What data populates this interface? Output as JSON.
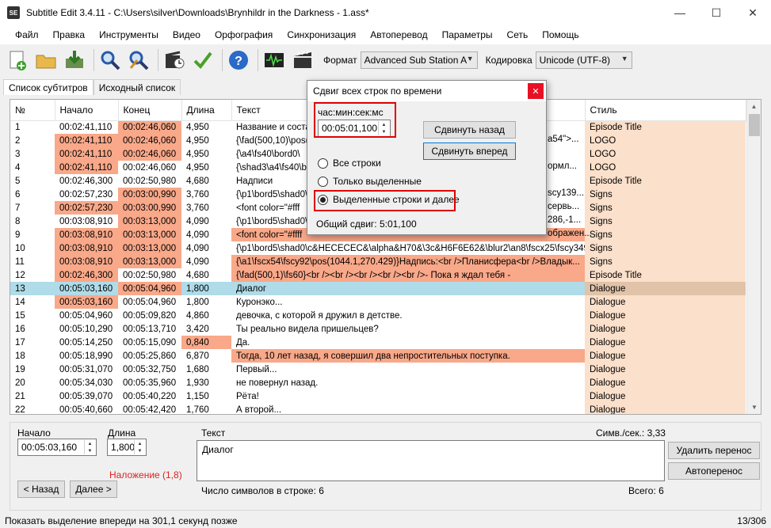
{
  "window": {
    "title": "Subtitle Edit 3.4.11 - C:\\Users\\silver\\Downloads\\Brynhildr in the Darkness - 1.ass*",
    "app_icon": "SE"
  },
  "menu": [
    "Файл",
    "Правка",
    "Инструменты",
    "Видео",
    "Орфография",
    "Синхронизация",
    "Автоперевод",
    "Параметры",
    "Сеть",
    "Помощь"
  ],
  "toolbar": {
    "format_label": "Формат",
    "format_value": "Advanced Sub Station A",
    "encoding_label": "Кодировка",
    "encoding_value": "Unicode (UTF-8)"
  },
  "tabs": [
    "Список субтитров",
    "Исходный список"
  ],
  "grid": {
    "columns": [
      "№",
      "Начало",
      "Конец",
      "Длина",
      "Текст",
      "Стиль"
    ],
    "rows": [
      {
        "n": "1",
        "start": "00:02:41,110",
        "end": "00:02:46,060",
        "dur": "4,950",
        "text": "Название и соста",
        "style": "Episode Title",
        "hs": false,
        "he": true,
        "hd": false,
        "ht": false
      },
      {
        "n": "2",
        "start": "00:02:41,110",
        "end": "00:02:46,060",
        "dur": "4,950",
        "text": "{\\fad(500,10)\\pos(",
        "style": "LOGO",
        "hs": true,
        "he": true,
        "hd": false,
        "ht": false
      },
      {
        "n": "3",
        "start": "00:02:41,110",
        "end": "00:02:46,060",
        "dur": "4,950",
        "text": "{\\a4\\fs40\\bord0\\",
        "style": "LOGO",
        "hs": true,
        "he": true,
        "hd": false,
        "ht": false
      },
      {
        "n": "4",
        "start": "00:02:41,110",
        "end": "00:02:46,060",
        "dur": "4,950",
        "text": "{\\shad3\\a4\\fs40\\b",
        "style": "LOGO",
        "hs": true,
        "he": false,
        "hd": false,
        "ht": false
      },
      {
        "n": "5",
        "start": "00:02:46,300",
        "end": "00:02:50,980",
        "dur": "4,680",
        "text": "Надписи",
        "style": "Episode Title",
        "hs": false,
        "he": false,
        "hd": false,
        "ht": false
      },
      {
        "n": "6",
        "start": "00:02:57,230",
        "end": "00:03:00,990",
        "dur": "3,760",
        "text": "{\\p1\\bord5\\shad0\\",
        "style": "Signs",
        "hs": false,
        "he": true,
        "hd": false,
        "ht": false
      },
      {
        "n": "7",
        "start": "00:02:57,230",
        "end": "00:03:00,990",
        "dur": "3,760",
        "text": "<font color=\"#fff",
        "style": "Signs",
        "hs": true,
        "he": true,
        "hd": false,
        "ht": false
      },
      {
        "n": "8",
        "start": "00:03:08,910",
        "end": "00:03:13,000",
        "dur": "4,090",
        "text": "{\\p1\\bord5\\shad0\\",
        "style": "Signs",
        "hs": false,
        "he": true,
        "hd": false,
        "ht": false
      },
      {
        "n": "9",
        "start": "00:03:08,910",
        "end": "00:03:13,000",
        "dur": "4,090",
        "text": "<font color=\"#ffff",
        "style": "Signs",
        "hs": true,
        "he": true,
        "hd": false,
        "ht": true
      },
      {
        "n": "10",
        "start": "00:03:08,910",
        "end": "00:03:13,000",
        "dur": "4,090",
        "text": "{\\p1\\bord5\\shad0\\c&HECECEC&\\alpha&H70&\\3c&H6F6E62&\\blur2\\an8\\fscx25\\fscy349...",
        "style": "Signs",
        "hs": true,
        "he": true,
        "hd": false,
        "ht": false
      },
      {
        "n": "11",
        "start": "00:03:08,910",
        "end": "00:03:13,000",
        "dur": "4,090",
        "text": "{\\a1\\fscx54\\fscy92\\pos(1044.1,270.429)}Надпись:<br />Планисфера<br />Владык...",
        "style": "Signs",
        "hs": true,
        "he": true,
        "hd": false,
        "ht": true
      },
      {
        "n": "12",
        "start": "00:02:46,300",
        "end": "00:02:50,980",
        "dur": "4,680",
        "text": "{\\fad(500,1)\\fs60}<br /><br /><br /><br /><br />- Пока я ждал тебя -",
        "style": "Episode Title",
        "hs": true,
        "he": false,
        "hd": false,
        "ht": true
      },
      {
        "n": "13",
        "start": "00:05:03,160",
        "end": "00:05:04,960",
        "dur": "1,800",
        "text": "Диалог",
        "style": "Dialogue",
        "hs": false,
        "he": true,
        "hd": false,
        "ht": false,
        "sel": true
      },
      {
        "n": "14",
        "start": "00:05:03,160",
        "end": "00:05:04,960",
        "dur": "1,800",
        "text": "Куронэко...",
        "style": "Dialogue",
        "hs": true,
        "he": false,
        "hd": false,
        "ht": false
      },
      {
        "n": "15",
        "start": "00:05:04,960",
        "end": "00:05:09,820",
        "dur": "4,860",
        "text": "девочка, с которой я дружил в детстве.",
        "style": "Dialogue",
        "hs": false,
        "he": false,
        "hd": false,
        "ht": false
      },
      {
        "n": "16",
        "start": "00:05:10,290",
        "end": "00:05:13,710",
        "dur": "3,420",
        "text": "Ты реально видела пришельцев?",
        "style": "Dialogue",
        "hs": false,
        "he": false,
        "hd": false,
        "ht": false
      },
      {
        "n": "17",
        "start": "00:05:14,250",
        "end": "00:05:15,090",
        "dur": "0,840",
        "text": "Да.",
        "style": "Dialogue",
        "hs": false,
        "he": false,
        "hd": true,
        "ht": false
      },
      {
        "n": "18",
        "start": "00:05:18,990",
        "end": "00:05:25,860",
        "dur": "6,870",
        "text": "Тогда, 10 лет назад, я совершил два непростительных поступка.",
        "style": "Dialogue",
        "hs": false,
        "he": false,
        "hd": false,
        "ht": true
      },
      {
        "n": "19",
        "start": "00:05:31,070",
        "end": "00:05:32,750",
        "dur": "1,680",
        "text": "Первый...",
        "style": "Dialogue",
        "hs": false,
        "he": false,
        "hd": false,
        "ht": false
      },
      {
        "n": "20",
        "start": "00:05:34,030",
        "end": "00:05:35,960",
        "dur": "1,930",
        "text": "не повернул назад.",
        "style": "Dialogue",
        "hs": false,
        "he": false,
        "hd": false,
        "ht": false
      },
      {
        "n": "21",
        "start": "00:05:39,070",
        "end": "00:05:40,220",
        "dur": "1,150",
        "text": "Рёта!",
        "style": "Dialogue",
        "hs": false,
        "he": false,
        "hd": false,
        "ht": false
      },
      {
        "n": "22",
        "start": "00:05:40,660",
        "end": "00:05:42,420",
        "dur": "1,760",
        "text": "А второй...",
        "style": "Dialogue",
        "hs": false,
        "he": false,
        "hd": false,
        "ht": false
      }
    ],
    "right_fragments": {
      "r2": "a54\">...",
      "r4": "ормл...",
      "r6": "scy139...",
      "r7": "сервь...",
      "r8": "286,-1...",
      "r9": "ображен..."
    }
  },
  "editor": {
    "start_label": "Начало",
    "start_value": "00:05:03,160",
    "duration_label": "Длина",
    "duration_value": "1,800",
    "text_label": "Текст",
    "text_value": "Диалог",
    "cps_label": "Симв./сек.: 3,33",
    "overlap": "Наложение (1,8)",
    "prev_button": "< Назад",
    "next_button": "Далее >",
    "line_chars": "Число символов в строке: 6",
    "total": "Всего: 6",
    "remove_break_button": "Удалить перенос",
    "auto_break_button": "Автоперенос"
  },
  "status": {
    "left": "Показать выделение впереди на 301,1 секунд позже",
    "right": "13/306"
  },
  "dialog": {
    "title": "Сдвиг всех строк по времени",
    "time_label": "час:мин:сек:мс",
    "time_value": "00:05:01,100",
    "back_button": "Сдвинуть назад",
    "forward_button": "Сдвинуть вперед",
    "radio_all": "Все строки",
    "radio_selected": "Только выделенные",
    "radio_selected_after": "Выделенные строки и далее",
    "total_shift": "Общий сдвиг: 5:01,100"
  },
  "colors": {
    "highlight_red": "#f9a889",
    "style_bg": "#fbe0cb",
    "selected_row": "#b0dbe8",
    "annotation_red": "#e00000"
  }
}
